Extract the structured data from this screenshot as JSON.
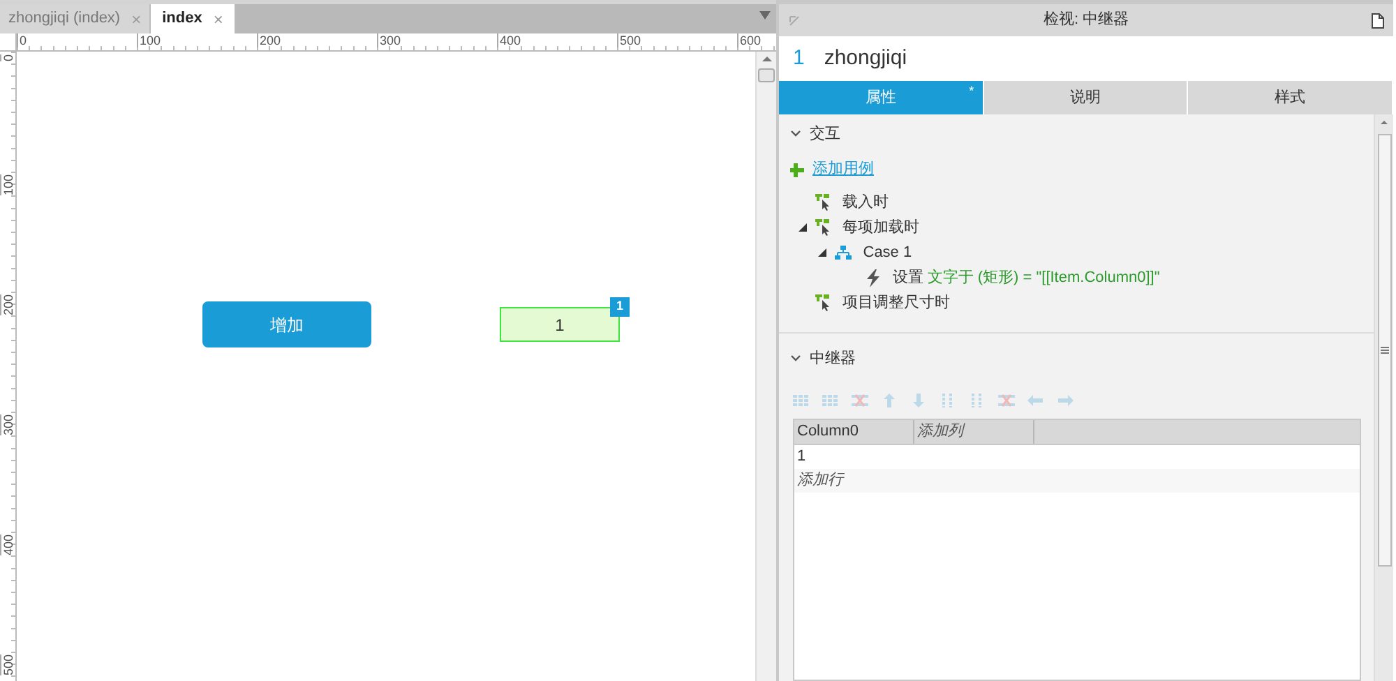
{
  "editor": {
    "tabs": [
      {
        "label": "zhongjiqi (index)",
        "selected": false,
        "close": "×"
      },
      {
        "label": "index",
        "selected": true,
        "close": "×"
      }
    ],
    "ruler": {
      "x_labels": [
        "0",
        "100",
        "200",
        "300",
        "400",
        "500",
        "600"
      ],
      "y_labels": [
        "0",
        "100",
        "200",
        "300",
        "400",
        "500"
      ]
    },
    "canvas": {
      "widgets": [
        {
          "kind": "button",
          "label": "增加"
        },
        {
          "kind": "repeater",
          "label": "1",
          "badge": "1",
          "selected": true
        }
      ]
    }
  },
  "inspector": {
    "title": "检视: 中继器",
    "widget_number": "1",
    "widget_name": "zhongjiqi",
    "tabs": [
      {
        "label": "属性",
        "selected": true,
        "marker": "*"
      },
      {
        "label": "说明",
        "selected": false
      },
      {
        "label": "样式",
        "selected": false
      }
    ],
    "interactions": {
      "heading": "交互",
      "expanded": true,
      "add_case": "添加用例",
      "events": [
        {
          "kind": "event",
          "label": "载入时"
        },
        {
          "kind": "event",
          "label": "每项加载时",
          "expanded": true,
          "children": [
            {
              "kind": "case",
              "label": "Case 1",
              "expanded": true,
              "children": [
                {
                  "kind": "action",
                  "label": "设置",
                  "detail": "文字于 (矩形) = \"[[Item.Column0]]\""
                }
              ]
            }
          ]
        },
        {
          "kind": "event",
          "label": "项目调整尺寸时"
        }
      ]
    },
    "repeater": {
      "heading": "中继器",
      "expanded": true,
      "columns": [
        {
          "kind": "column",
          "label": "Column0"
        },
        {
          "kind": "add",
          "label": "添加列"
        }
      ],
      "rows": [
        {
          "kind": "row",
          "cells": [
            "1"
          ]
        },
        {
          "kind": "add",
          "cells": [
            "添加行"
          ]
        }
      ]
    }
  }
}
